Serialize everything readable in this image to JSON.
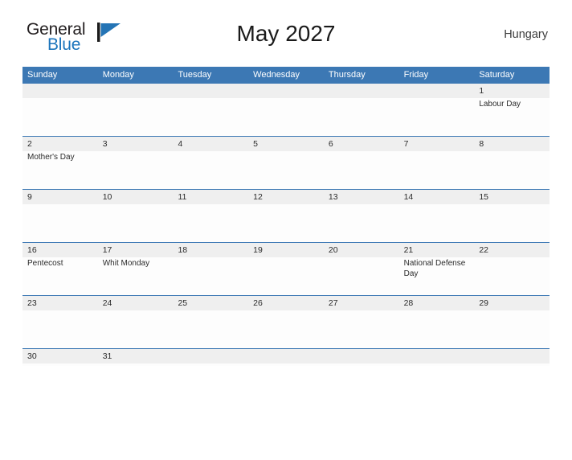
{
  "brand": {
    "name_part1": "General",
    "name_part2": "Blue",
    "flag_icon": "blue-flag-triangle-icon",
    "color_dark": "#231f20",
    "color_blue": "#1c75bc"
  },
  "header": {
    "title": "May 2027",
    "country": "Hungary"
  },
  "theme": {
    "header_blue": "#3c78b4",
    "band_gray": "#efefef",
    "row_border": "#3c78b4",
    "text_dark": "#2b2b2b"
  },
  "weekdays": [
    "Sunday",
    "Monday",
    "Tuesday",
    "Wednesday",
    "Thursday",
    "Friday",
    "Saturday"
  ],
  "weeks": [
    {
      "days": [
        {
          "num": "",
          "events": []
        },
        {
          "num": "",
          "events": []
        },
        {
          "num": "",
          "events": []
        },
        {
          "num": "",
          "events": []
        },
        {
          "num": "",
          "events": []
        },
        {
          "num": "",
          "events": []
        },
        {
          "num": "1",
          "events": [
            "Labour Day"
          ]
        }
      ]
    },
    {
      "days": [
        {
          "num": "2",
          "events": [
            "Mother's Day"
          ]
        },
        {
          "num": "3",
          "events": []
        },
        {
          "num": "4",
          "events": []
        },
        {
          "num": "5",
          "events": []
        },
        {
          "num": "6",
          "events": []
        },
        {
          "num": "7",
          "events": []
        },
        {
          "num": "8",
          "events": []
        }
      ]
    },
    {
      "days": [
        {
          "num": "9",
          "events": []
        },
        {
          "num": "10",
          "events": []
        },
        {
          "num": "11",
          "events": []
        },
        {
          "num": "12",
          "events": []
        },
        {
          "num": "13",
          "events": []
        },
        {
          "num": "14",
          "events": []
        },
        {
          "num": "15",
          "events": []
        }
      ]
    },
    {
      "days": [
        {
          "num": "16",
          "events": [
            "Pentecost"
          ]
        },
        {
          "num": "17",
          "events": [
            "Whit Monday"
          ]
        },
        {
          "num": "18",
          "events": []
        },
        {
          "num": "19",
          "events": []
        },
        {
          "num": "20",
          "events": []
        },
        {
          "num": "21",
          "events": [
            "National Defense Day"
          ]
        },
        {
          "num": "22",
          "events": []
        }
      ]
    },
    {
      "days": [
        {
          "num": "23",
          "events": []
        },
        {
          "num": "24",
          "events": []
        },
        {
          "num": "25",
          "events": []
        },
        {
          "num": "26",
          "events": []
        },
        {
          "num": "27",
          "events": []
        },
        {
          "num": "28",
          "events": []
        },
        {
          "num": "29",
          "events": []
        }
      ]
    },
    {
      "days": [
        {
          "num": "30",
          "events": []
        },
        {
          "num": "31",
          "events": []
        },
        {
          "num": "",
          "events": []
        },
        {
          "num": "",
          "events": []
        },
        {
          "num": "",
          "events": []
        },
        {
          "num": "",
          "events": []
        },
        {
          "num": "",
          "events": []
        }
      ]
    }
  ]
}
